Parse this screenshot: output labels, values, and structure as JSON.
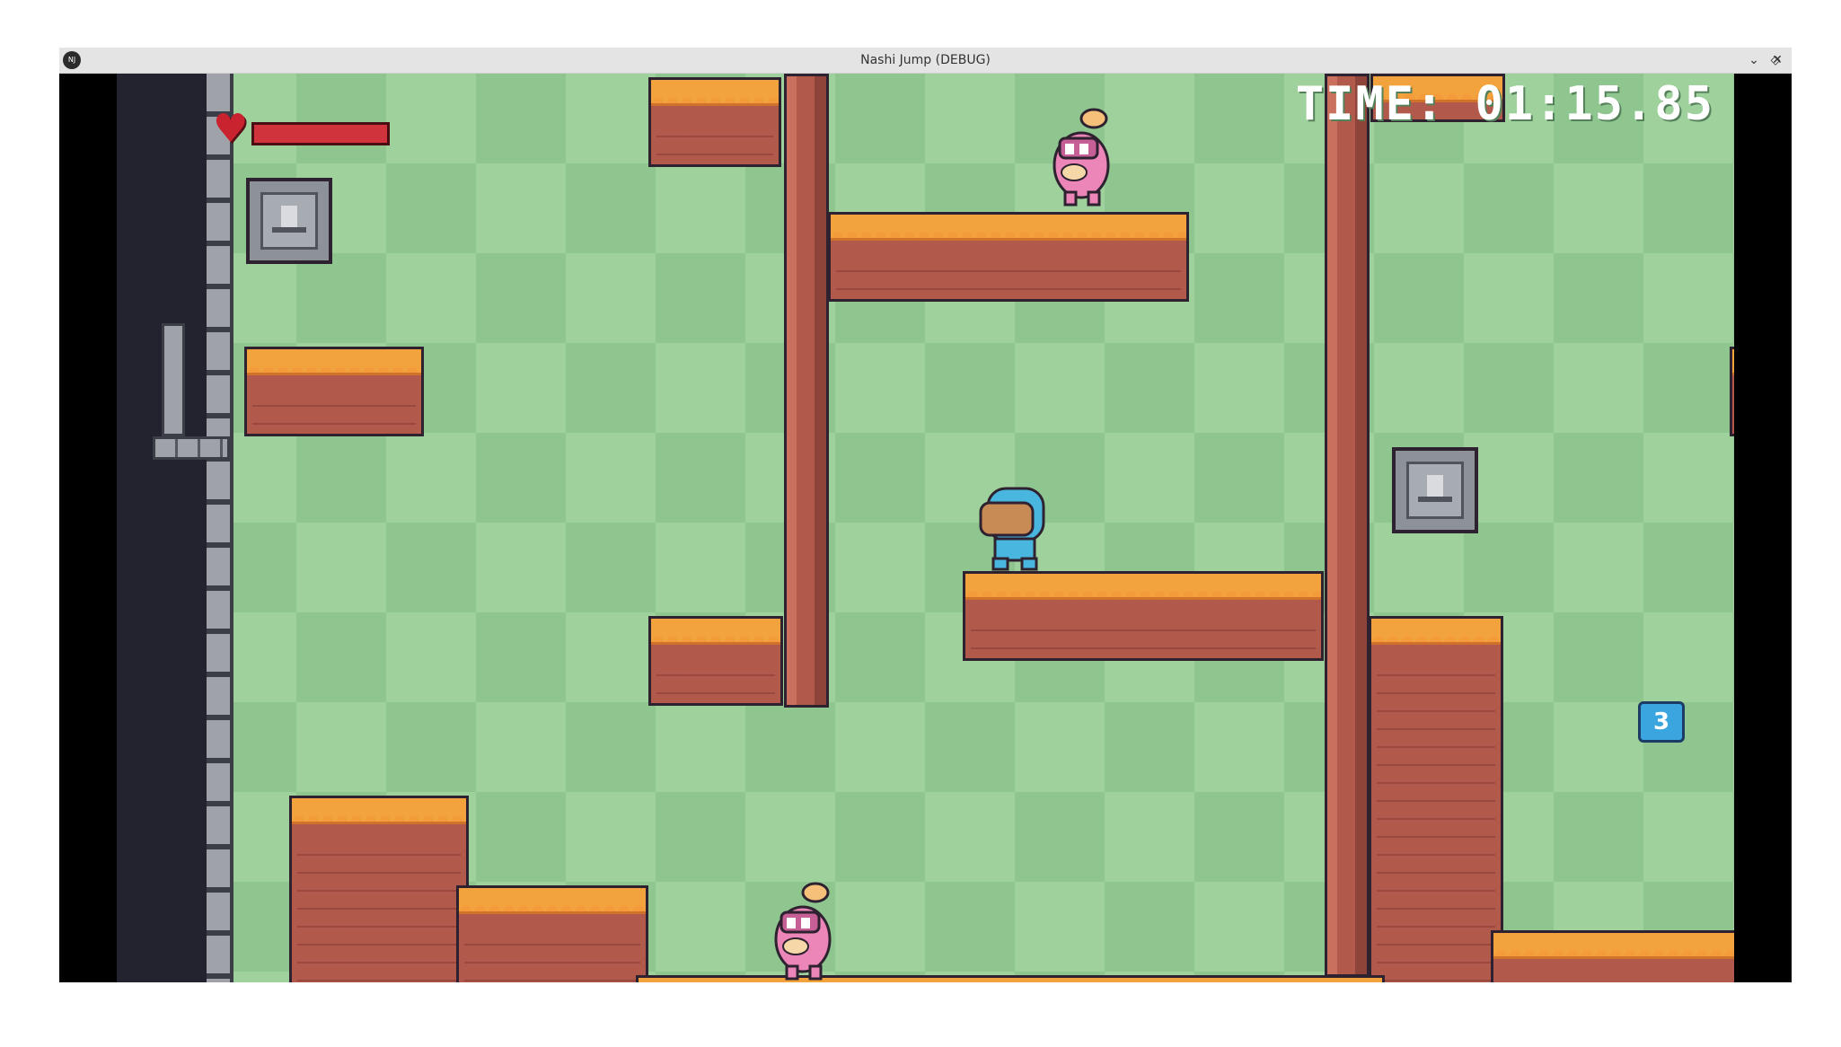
{
  "window": {
    "title": "Nashi Jump (DEBUG)",
    "app_icon_label": "NJ",
    "controls": {
      "minimize": "⌄",
      "maximize": "◇",
      "close": "✕"
    }
  },
  "hud": {
    "timer": "TIME: 01:15.85",
    "health_fraction": 1.0,
    "item_counter": "3"
  },
  "colors": {
    "background_light": "#9fd19c",
    "background_dark": "#8fc68f",
    "grass_top": "#f3a33d",
    "dirt": "#b15a4b",
    "health": "#c9232f",
    "player": "#49b6e0",
    "enemy": "#ec86b8"
  },
  "entities": [
    {
      "type": "player",
      "icon": "blue-hooded-player-icon"
    },
    {
      "type": "enemy",
      "icon": "pink-bunny-icon"
    },
    {
      "type": "enemy",
      "icon": "pink-bunny-icon"
    },
    {
      "type": "hazard",
      "icon": "stone-face-block-icon"
    },
    {
      "type": "hazard",
      "icon": "stone-face-block-icon"
    }
  ]
}
